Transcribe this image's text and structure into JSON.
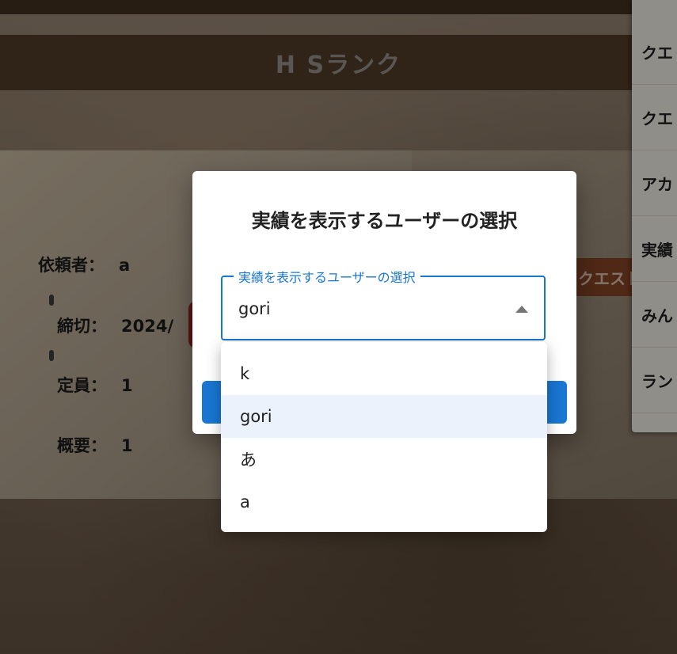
{
  "background": {
    "rank_title": "H  Sランク",
    "wood_label": "クエスト"
  },
  "quest_info": [
    {
      "label": "依頼者：",
      "value": "a"
    },
    {
      "label": "締切：",
      "value": "2024/"
    },
    {
      "label": "定員：",
      "value": "1"
    },
    {
      "label": "概要：",
      "value": "1"
    }
  ],
  "side_menu": {
    "items": [
      {
        "label": "クエ"
      },
      {
        "label": "クエ"
      },
      {
        "label": "アカ"
      },
      {
        "label": "実績"
      },
      {
        "label": "みん"
      },
      {
        "label": "ラン"
      }
    ]
  },
  "dialog": {
    "title": "実績を表示するユーザーの選択",
    "select": {
      "label": "実績を表示するユーザーの選択",
      "value": "gori"
    },
    "button_color": "#1976d2"
  },
  "dropdown": {
    "options": [
      {
        "label": "k",
        "selected": false
      },
      {
        "label": "gori",
        "selected": true
      },
      {
        "label": "あ",
        "selected": false
      },
      {
        "label": "a",
        "selected": false
      }
    ]
  },
  "colors": {
    "accent": "#1976d2",
    "selected_option_bg": "#ebf2fb"
  }
}
